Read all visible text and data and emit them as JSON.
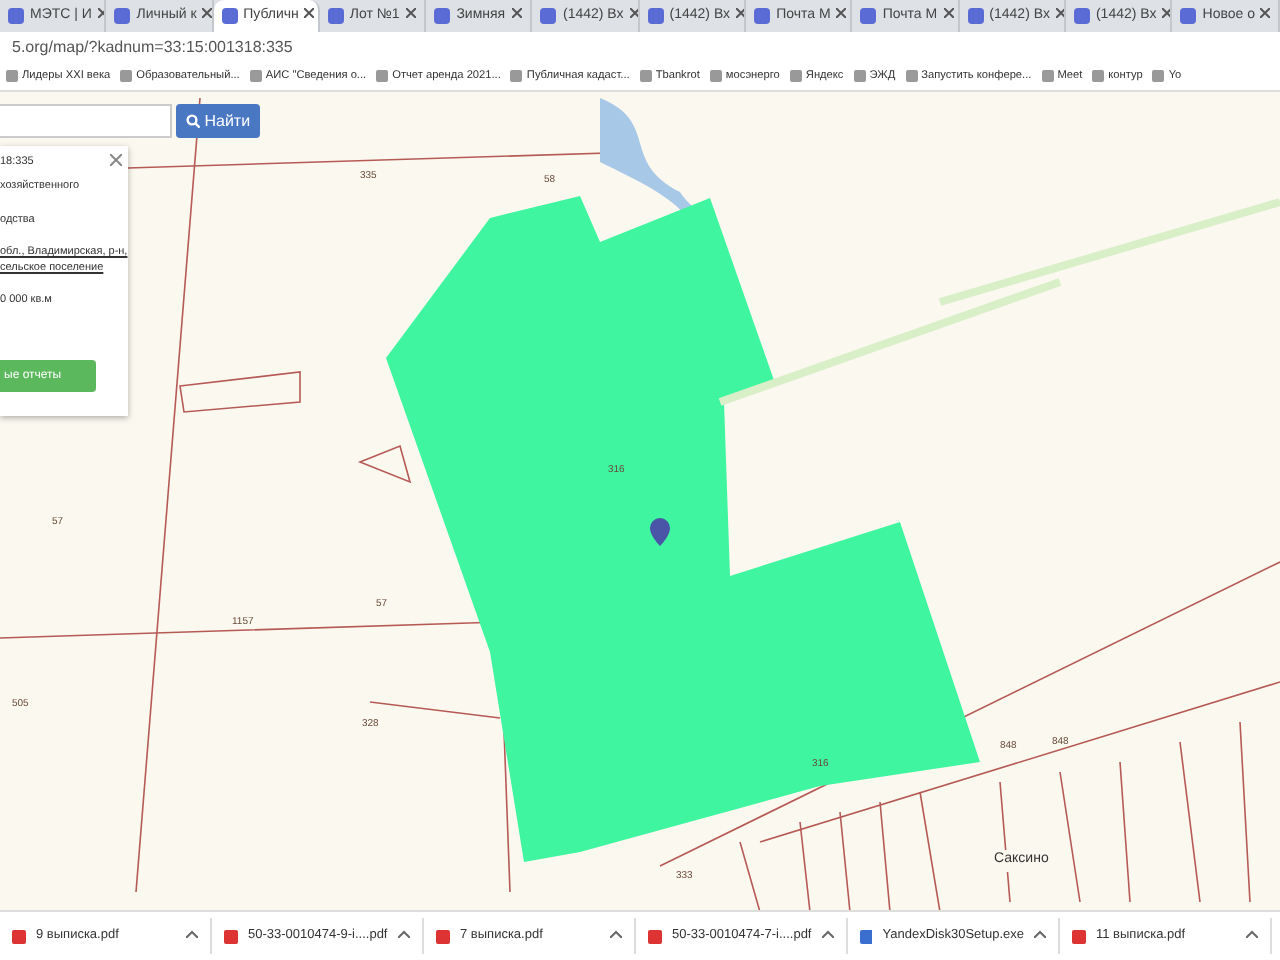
{
  "tabs": [
    {
      "label": "МЭТС | И",
      "selected": false
    },
    {
      "label": "Личный к",
      "selected": false
    },
    {
      "label": "Публичн",
      "selected": true
    },
    {
      "label": "Лот №1",
      "selected": false
    },
    {
      "label": "Зимняя",
      "selected": false
    },
    {
      "label": "(1442) Вх",
      "selected": false
    },
    {
      "label": "(1442) Вх",
      "selected": false
    },
    {
      "label": "Почта М",
      "selected": false
    },
    {
      "label": "Почта М",
      "selected": false
    },
    {
      "label": "(1442) Вх",
      "selected": false
    },
    {
      "label": "(1442) Вх",
      "selected": false
    },
    {
      "label": "Новое о",
      "selected": false
    }
  ],
  "address": "5.org/map/?kadnum=33:15:001318:335",
  "bookmarks": [
    "Лидеры XXI века",
    "Образовательный...",
    "АИС \"Сведения о...",
    "Отчет аренда 2021...",
    "Публичная кадаст...",
    "Tbankrot",
    "мосэнерго",
    "Яндекс",
    "ЭЖД",
    "Запустить конфере...",
    "Meet",
    "контур",
    "Yo"
  ],
  "search": {
    "button": "Найти"
  },
  "info_card": {
    "number_link": "18:335",
    "lines": [
      "хозяйственного",
      "одства"
    ],
    "address_link": "обл., Владимирская, р-н, сельское поселение",
    "area": "0 000 кв.м",
    "button": "ые отчеты"
  },
  "map_labels": [
    "335",
    "58",
    "57",
    "57",
    "1157",
    "505",
    "328",
    "316",
    "316",
    "848",
    "848",
    "333",
    "Саксино"
  ],
  "downloads": [
    {
      "name": "9 выписка.pdf",
      "kind": "pdf"
    },
    {
      "name": "50-33-0010474-9-i....pdf",
      "kind": "pdf"
    },
    {
      "name": "7 выписка.pdf",
      "kind": "pdf"
    },
    {
      "name": "50-33-0010474-7-i....pdf",
      "kind": "pdf"
    },
    {
      "name": "YandexDisk30Setup.exe",
      "kind": "exe"
    },
    {
      "name": "11 выписка.pdf",
      "kind": "pdf"
    }
  ]
}
